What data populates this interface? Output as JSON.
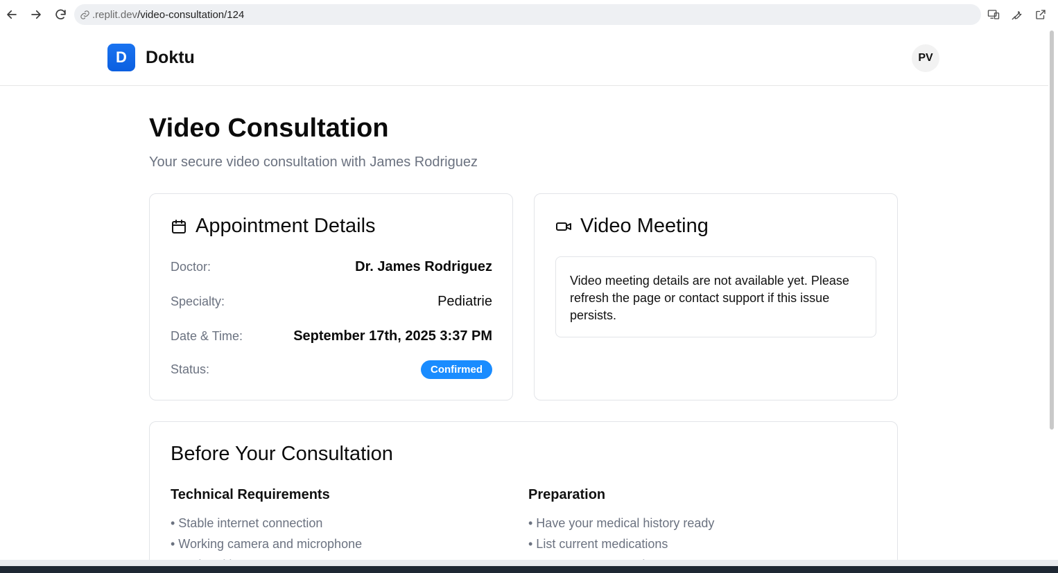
{
  "browser": {
    "url_host": ".replit.dev",
    "url_path": "/video-consultation/124",
    "icons": [
      "back-icon",
      "forward-icon",
      "reload-icon",
      "link-icon",
      "devices-icon",
      "wrench-icon",
      "external-link-icon"
    ]
  },
  "header": {
    "logo_letter": "D",
    "brand": "Doktu",
    "avatar_initials": "PV"
  },
  "page": {
    "title": "Video Consultation",
    "subtitle": "Your secure video consultation with James Rodriguez"
  },
  "appointment": {
    "title": "Appointment Details",
    "doctor_label": "Doctor:",
    "doctor_value": "Dr. James Rodriguez",
    "specialty_label": "Specialty:",
    "specialty_value": "Pediatrie",
    "datetime_label": "Date & Time:",
    "datetime_value": "September 17th, 2025 3:37 PM",
    "status_label": "Status:",
    "status_value": "Confirmed",
    "status_color": "#1a8cff"
  },
  "video": {
    "title": "Video Meeting",
    "notice": "Video meeting details are not available yet. Please refresh the page or contact support if this issue persists."
  },
  "before": {
    "title": "Before Your Consultation",
    "technical": {
      "heading": "Technical Requirements",
      "items": [
        "• Stable internet connection",
        "• Working camera and microphone",
        "• Updated browser or Zoom app"
      ]
    },
    "preparation": {
      "heading": "Preparation",
      "items": [
        "• Have your medical history ready",
        "• List current medications",
        "• Prepare your questions"
      ]
    }
  }
}
